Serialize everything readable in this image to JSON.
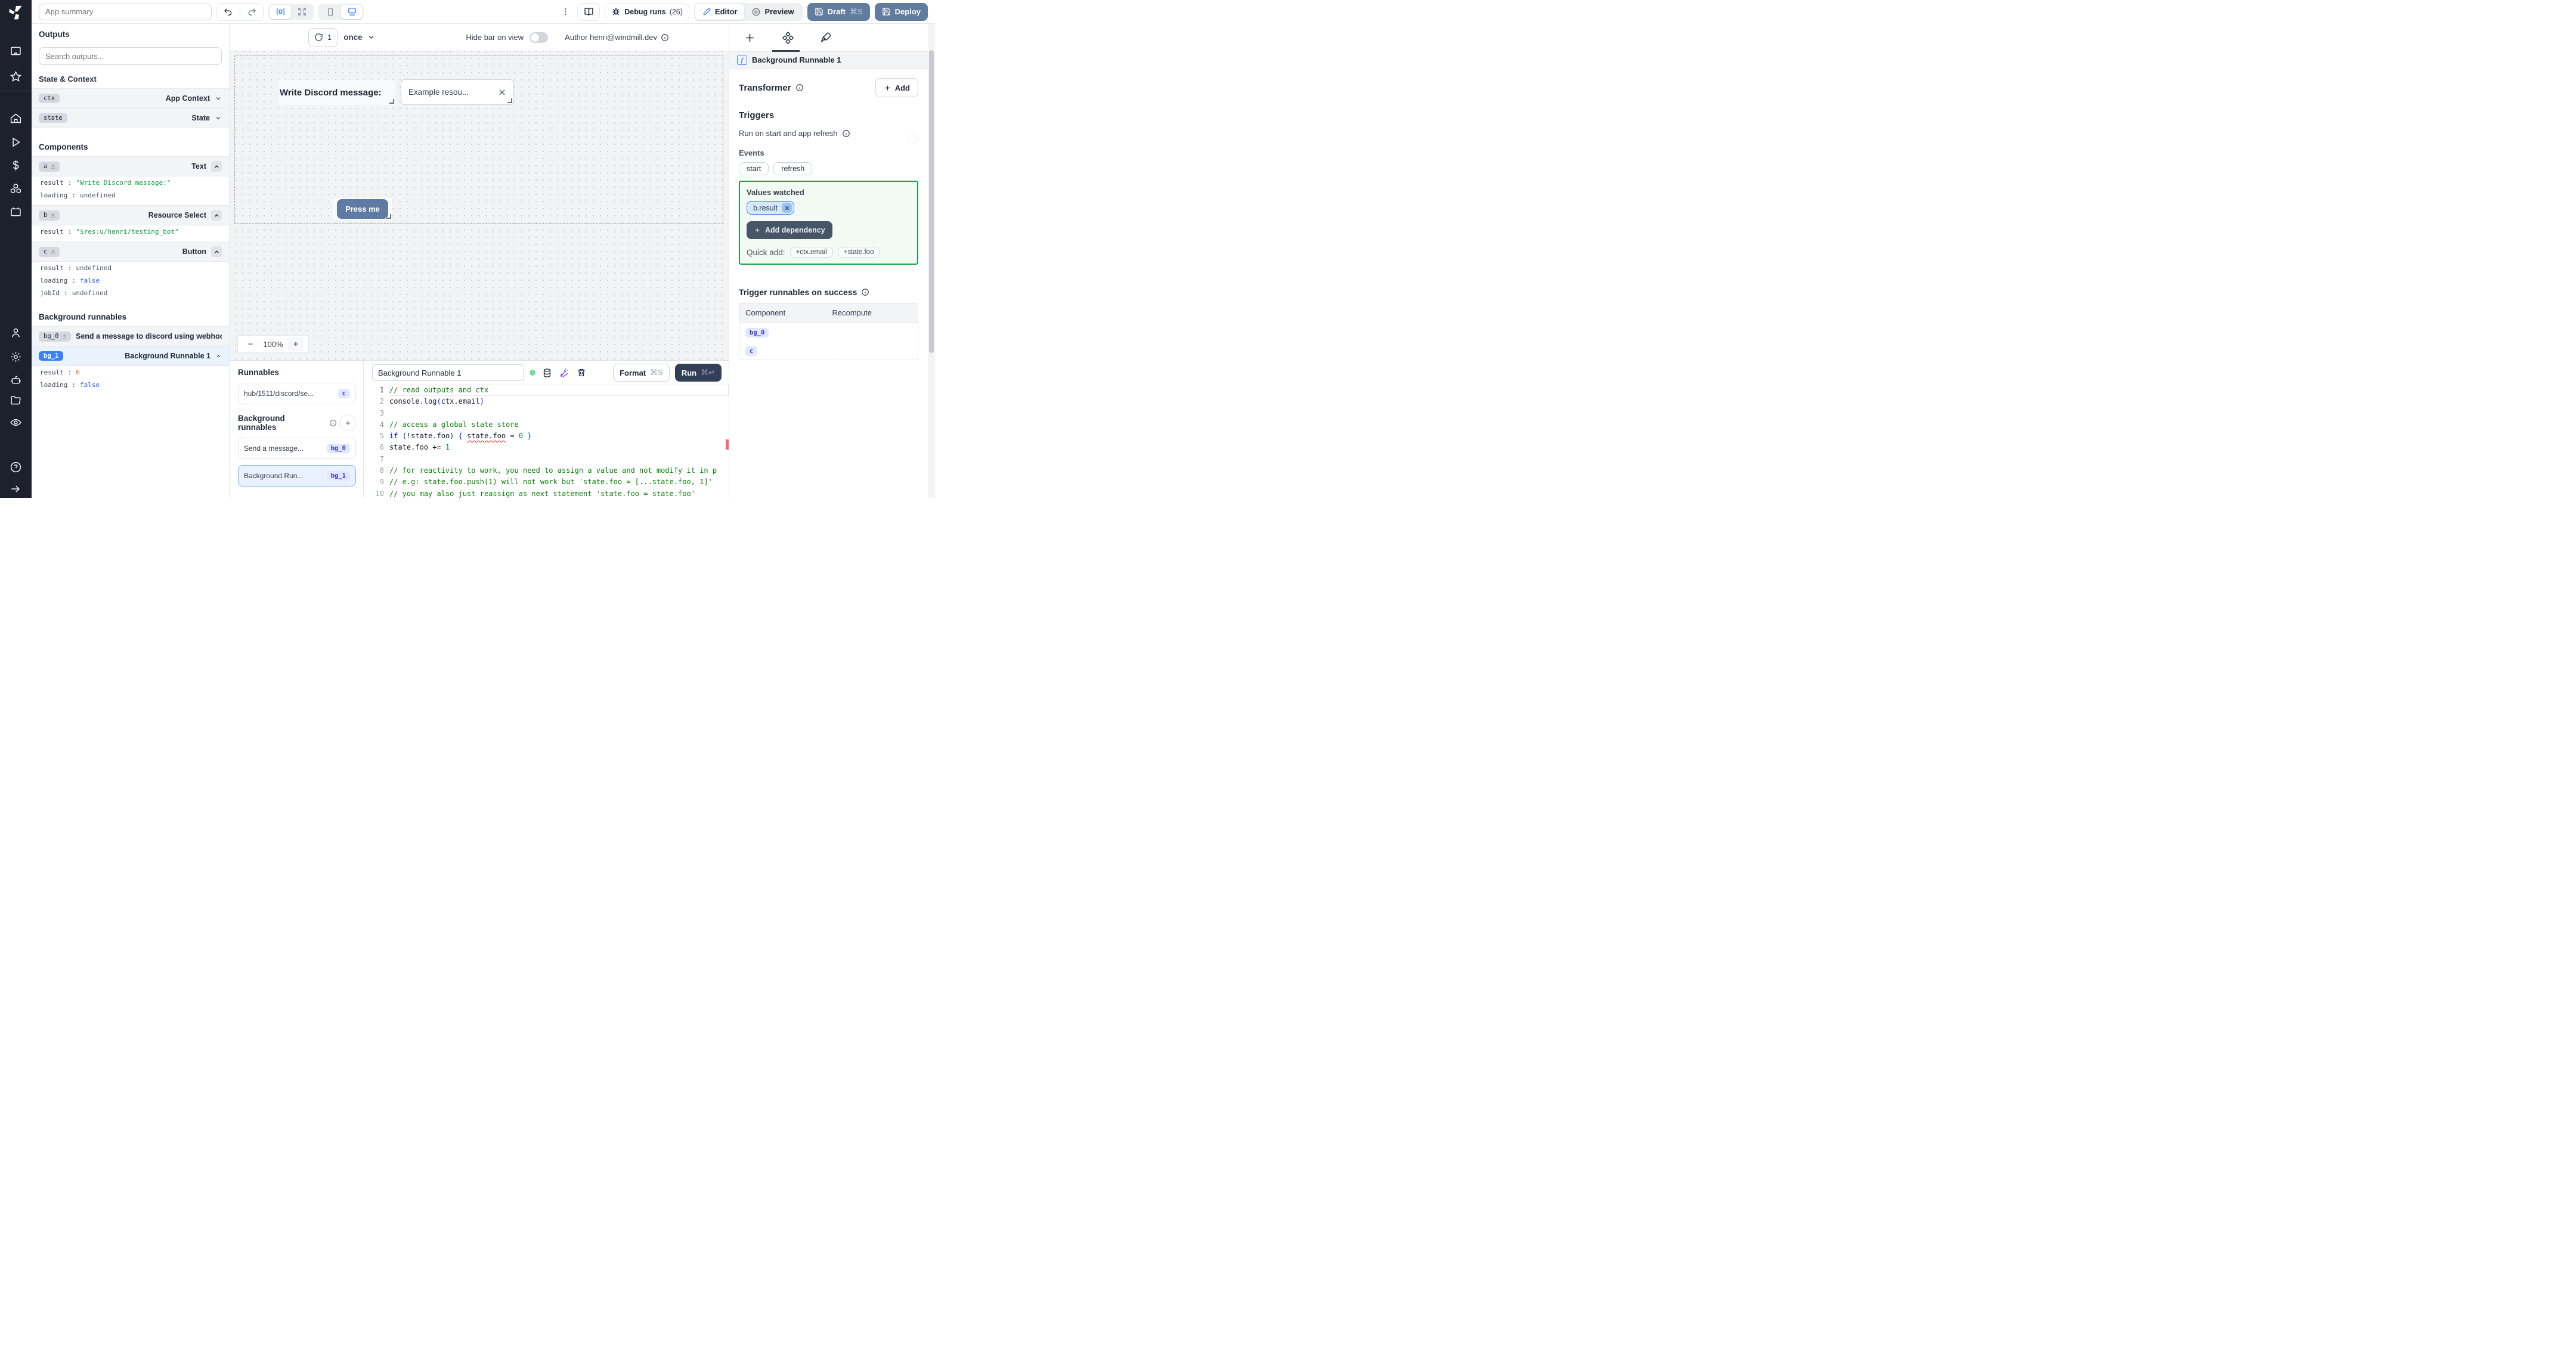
{
  "topbar": {
    "app_summary_placeholder": "App summary",
    "debug_runs_label": "Debug runs",
    "debug_runs_count": "(26)",
    "editor_label": "Editor",
    "preview_label": "Preview",
    "draft_label": "Draft",
    "draft_shortcut": "⌘S",
    "deploy_label": "Deploy"
  },
  "canvas_toolbar": {
    "refresh_count": "1",
    "run_frequency": "once",
    "hide_bar_label": "Hide bar on view",
    "author_label": "Author henri@windmill.dev"
  },
  "canvas": {
    "text_component": "Write Discord message:",
    "resource_select_value": "Example resou...",
    "button_label": "Press me",
    "zoom_out": "−",
    "zoom_level": "100%",
    "zoom_in": "+"
  },
  "outputs": {
    "title": "Outputs",
    "search_placeholder": "Search outputs...",
    "state_context_title": "State & Context",
    "ctx": {
      "id": "ctx",
      "type": "App Context"
    },
    "state": {
      "id": "state",
      "type": "State"
    },
    "components_title": "Components",
    "a": {
      "id": "a",
      "type": "Text",
      "result_key": "result",
      "result": "\"Write Discord message:\"",
      "loading_key": "loading",
      "loading": "undefined"
    },
    "b": {
      "id": "b",
      "type": "Resource Select",
      "result_key": "result",
      "result": "\"$res:u/henri/testing_bot\""
    },
    "c": {
      "id": "c",
      "type": "Button",
      "result_key": "result",
      "result": "undefined",
      "loading_key": "loading",
      "loading": "false",
      "jobid_key": "jobId",
      "jobid": "undefined"
    },
    "bg_title": "Background runnables",
    "bg0": {
      "id": "bg_0",
      "label": "Send a message to discord using webhoo"
    },
    "bg1": {
      "id": "bg_1",
      "label": "Background Runnable 1",
      "result_key": "result",
      "result": "6",
      "loading_key": "loading",
      "loading": "false"
    }
  },
  "runnables_panel": {
    "title": "Runnables",
    "hub_card_label": "hub/1511/discord/se...",
    "hub_card_badge": "c",
    "bg_section_title": "Background runnables",
    "bg0_label": "Send a message...",
    "bg0_badge": "bg_0",
    "bg1_label": "Background Run...",
    "bg1_badge": "bg_1"
  },
  "editor": {
    "title_value": "Background Runnable 1",
    "format_label": "Format",
    "format_shortcut": "⌘S",
    "run_label": "Run",
    "run_shortcut": "⌘↵"
  },
  "code": {
    "language_hint": "javascript",
    "lines": [
      [
        [
          "cm",
          "// read outputs and ctx"
        ]
      ],
      [
        [
          "pl",
          "console.log"
        ],
        [
          "br",
          "("
        ],
        [
          "pl",
          "ctx.email"
        ],
        [
          "br",
          ")"
        ]
      ],
      [],
      [
        [
          "cm",
          "// access a global state store"
        ]
      ],
      [
        [
          "kw",
          "if"
        ],
        [
          "pl",
          " "
        ],
        [
          "br",
          "("
        ],
        [
          "pl",
          "!state.foo"
        ],
        [
          "br",
          ")"
        ],
        [
          "pl",
          " "
        ],
        [
          "br",
          "{"
        ],
        [
          "pl",
          " "
        ],
        [
          "err",
          "state.foo"
        ],
        [
          "pl",
          " = "
        ],
        [
          "num",
          "0"
        ],
        [
          "pl",
          " "
        ],
        [
          "br",
          "}"
        ]
      ],
      [
        [
          "pl",
          "state.foo += "
        ],
        [
          "num",
          "1"
        ]
      ],
      [],
      [
        [
          "cm",
          "// for reactivity to work, you need to assign a value and not modify it in p"
        ]
      ],
      [
        [
          "cm",
          "// e.g: state.foo.push(1) will not work but 'state.foo = [...state.foo, 1]'"
        ]
      ],
      [
        [
          "cm",
          "// you may also just reassign as next statement 'state.foo = state.foo'"
        ]
      ]
    ]
  },
  "right_panel": {
    "component_header": "Background Runnable 1",
    "transformer_label": "Transformer",
    "add_label": "Add",
    "triggers_title": "Triggers",
    "run_on_start_label": "Run on start and app refresh",
    "events_label": "Events",
    "event_chips": [
      "start",
      "refresh"
    ],
    "values_watched_label": "Values watched",
    "watched_value": "b.result",
    "add_dependency_label": "Add dependency",
    "quick_add_label": "Quick add:",
    "quick_add_chips": [
      "+ctx.email",
      "+state.foo"
    ],
    "trigger_success_label": "Trigger runnables on success",
    "table": {
      "headers": [
        "Component",
        "Recompute"
      ],
      "rows": [
        {
          "component": "bg_0"
        },
        {
          "component": "c"
        }
      ]
    }
  },
  "colors": {
    "rail_bg": "#1c212c",
    "accent_blue": "#3b82f6",
    "toggle_on_blue": "#2563eb",
    "slate_button": "#5f7ba3",
    "deploy_button": "#617c9e",
    "run_button": "#333f56",
    "string_green": "#16a34a",
    "bool_blue": "#2563eb",
    "number_orange": "#ea580c",
    "watch_border_green": "#16a34a",
    "badge_indigo_bg": "#e0e7ff",
    "badge_indigo_text": "#4338ca",
    "wand_purple": "#7c3aed"
  }
}
